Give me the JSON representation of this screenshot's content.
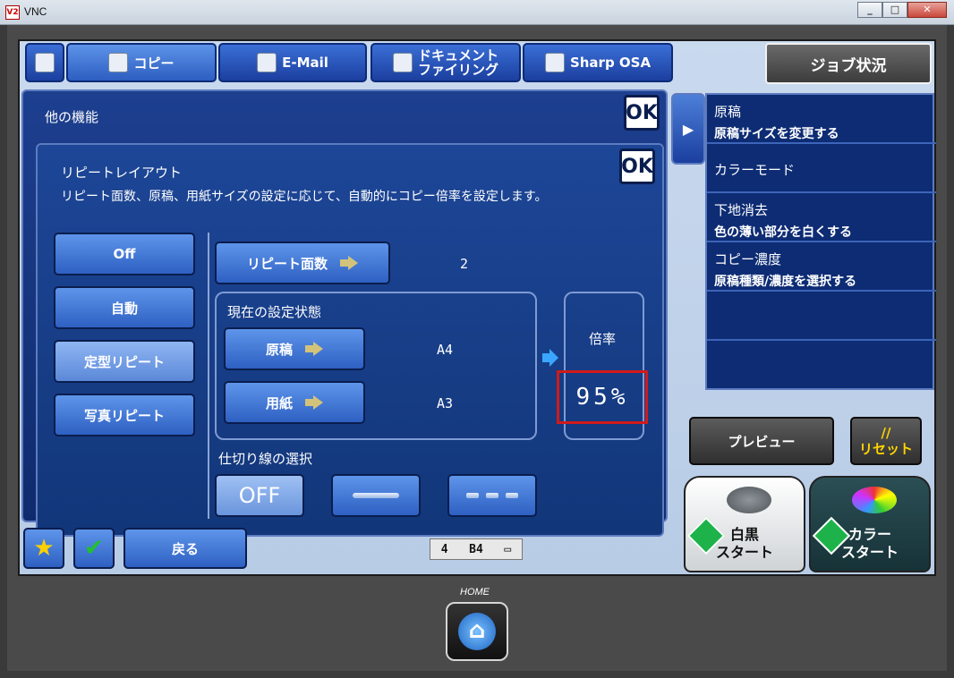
{
  "window": {
    "app_icon": "V2",
    "title": "VNC",
    "buttons": [
      "_",
      "□",
      "✕"
    ]
  },
  "tabs": [
    {
      "label": "コピー",
      "icon": "copy-icon"
    },
    {
      "label": "E-Mail",
      "icon": "email-icon"
    },
    {
      "label_line1": "ドキュメント",
      "label_line2": "ファイリング",
      "icon": "document-filing-icon"
    },
    {
      "label": "Sharp OSA",
      "icon": "osa-icon"
    }
  ],
  "job_status": "ジョブ状況",
  "other_functions": {
    "title": "他の機能",
    "ok": "OK"
  },
  "repeat_layout": {
    "title": "リピートレイアウト",
    "description": "リピート面数、原稿、用紙サイズの設定に応じて、自動的にコピー倍率を設定します。",
    "ok": "OK",
    "modes": [
      "Off",
      "自動",
      "定型リピート",
      "写真リピート"
    ],
    "selected_mode": "定型リピート",
    "repeat_count_label": "リピート面数",
    "repeat_count_value": "2",
    "current_settings_label": "現在の設定状態",
    "original_label": "原稿",
    "original_value": "A4",
    "paper_label": "用紙",
    "paper_value": "A3",
    "ratio_label": "倍率",
    "ratio_value": "95%",
    "divider_label": "仕切り線の選択",
    "divider_off": "OFF"
  },
  "bottom_left": {
    "back": "戻る",
    "status_left": "4",
    "status_center": "B4"
  },
  "side_menu": [
    {
      "line1": "原稿",
      "line2": "原稿サイズを変更する"
    },
    {
      "line1": "カラーモード",
      "line2": ""
    },
    {
      "line1": "下地消去",
      "line2": "色の薄い部分を白くする"
    },
    {
      "line1": "コピー濃度",
      "line2": "原稿種類/濃度を選択する"
    }
  ],
  "preview": "プレビュー",
  "reset": {
    "symbol": "//",
    "label": "リセット"
  },
  "start_mono": {
    "line1": "白黒",
    "line2": "スタート"
  },
  "start_color": {
    "line1": "カラー",
    "line2": "スタート"
  },
  "home_label": "HOME",
  "colors": {
    "panel": "#123679",
    "button": "#2e60c2",
    "highlight": "#d11a1a"
  }
}
